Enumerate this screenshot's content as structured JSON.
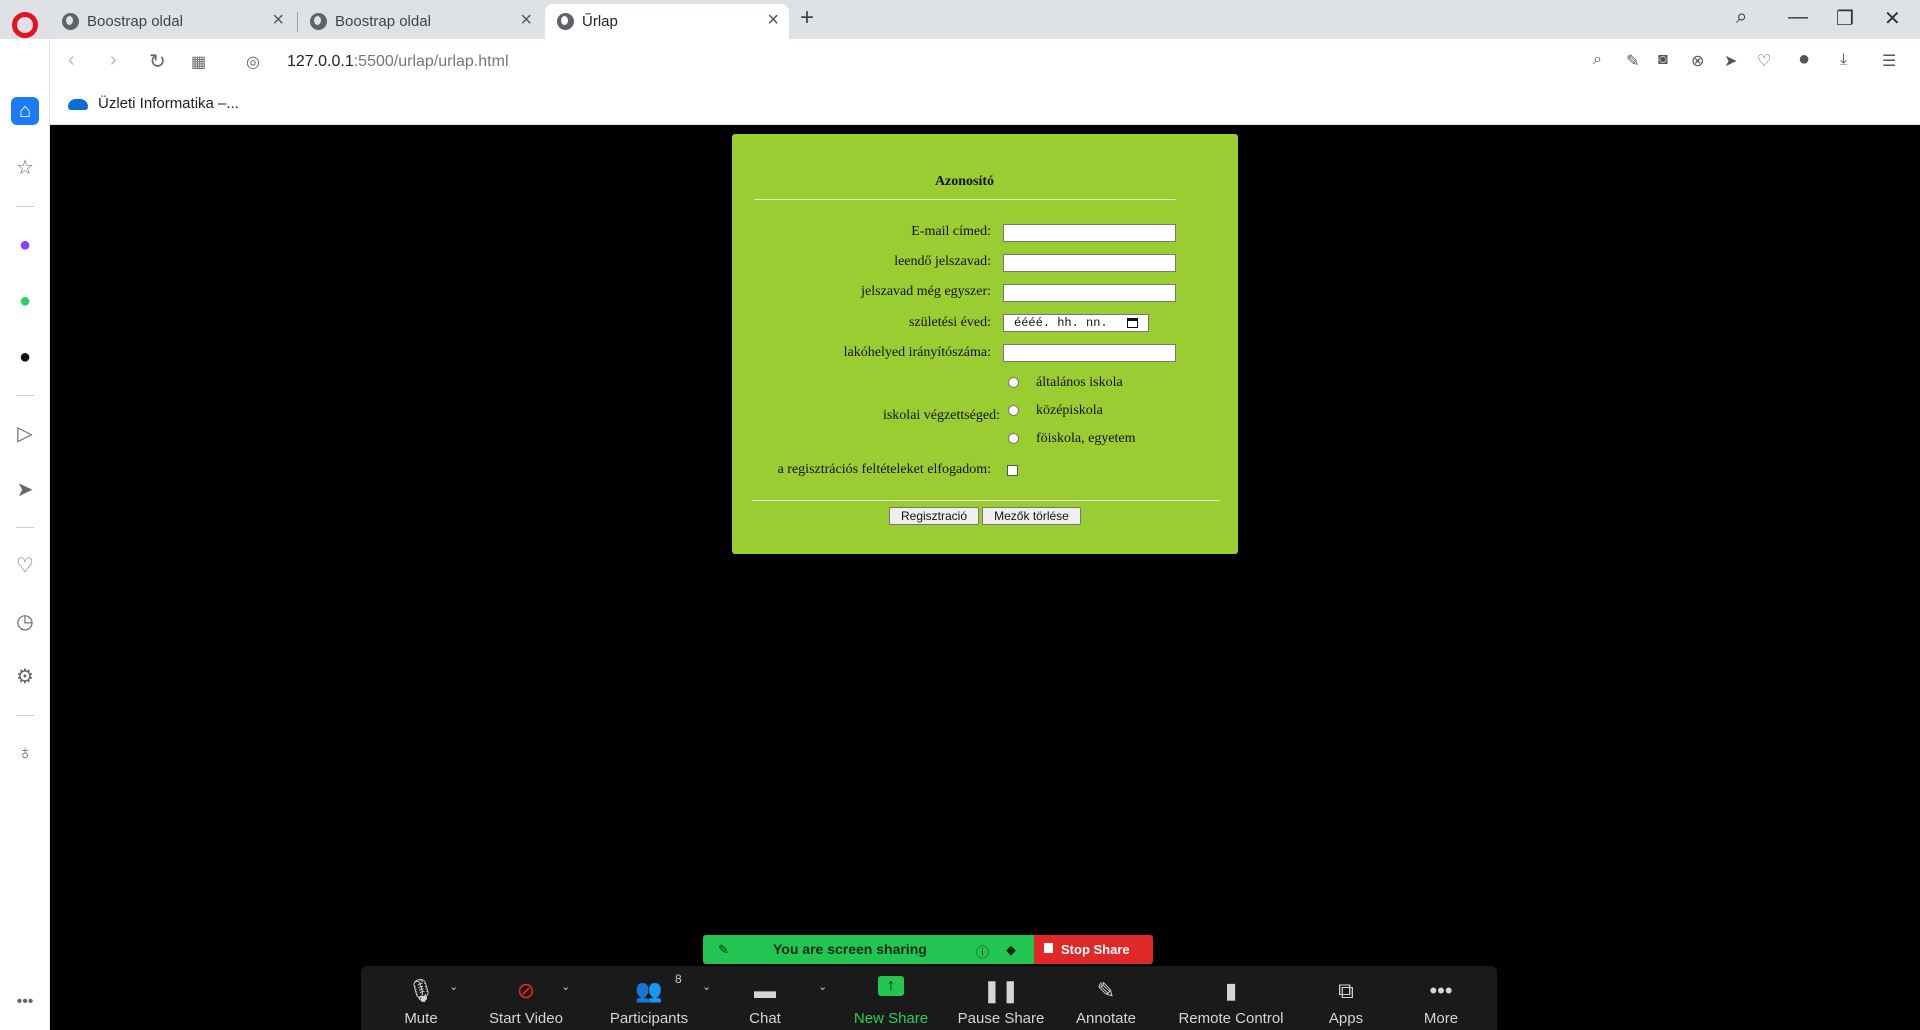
{
  "browser": {
    "tabs": [
      {
        "label": "Boostrap oldal"
      },
      {
        "label": "Boostrap oldal"
      },
      {
        "label": "Űrlap"
      }
    ],
    "url_host": "127.0.0.1",
    "url_rest": ":5500/urlap/urlap.html",
    "bookmark": "Üzleti Informatika –..."
  },
  "form": {
    "title": "Azonosító",
    "email_label": "E-mail címed:",
    "password_label": "leendő jelszavad:",
    "password2_label": "jelszavad még egyszer:",
    "birth_label": "születési éved:",
    "birth_placeholder": "éééé. hh. nn.",
    "zip_label": "lakóhelyed irányítószáma:",
    "education_label": "iskolai végzettséged:",
    "education_options": [
      "általános iskola",
      "középiskola",
      "föiskola, egyetem"
    ],
    "terms_label": "a regisztrációs feltételeket elfogadom:",
    "submit_label": "Regisztració",
    "reset_label": "Mezők törlése"
  },
  "share": {
    "status": "You are screen sharing",
    "stop": "Stop Share"
  },
  "zoom_toolbar": {
    "mute": "Mute",
    "start_video": "Start Video",
    "participants": "Participants",
    "participants_count": "8",
    "chat": "Chat",
    "new_share": "New Share",
    "pause_share": "Pause Share",
    "annotate": "Annotate",
    "remote_control": "Remote Control",
    "apps": "Apps",
    "more": "More"
  },
  "colors": {
    "form_bg": "#9acd32",
    "share_green": "#23c552",
    "stop_red": "#e02828",
    "sidebar_home": "#1b7cf5"
  }
}
